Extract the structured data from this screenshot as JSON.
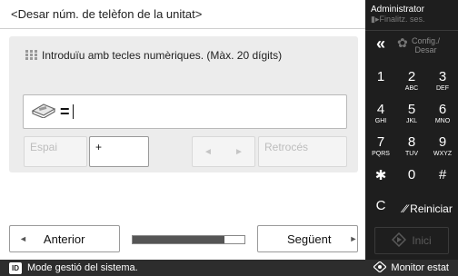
{
  "screen": {
    "title": "<Desar núm. de telèfon de la unitat>",
    "instruction": "Introduïu amb tecles numèriques. (Màx. 20 dígits)",
    "field_value": "=",
    "buttons": {
      "space": "Espai",
      "plus": "+",
      "left_arrow": "◄",
      "right_arrow": "►",
      "backspace": "Retrocés"
    },
    "nav": {
      "previous": "Anterior",
      "next": "Següent",
      "prev_arrow": "◄",
      "next_arrow": "►",
      "progress_fraction": 0.82
    }
  },
  "status_bar": {
    "badge": "ID",
    "message": "Mode gestió del sistema.",
    "monitor": "Monitor estat"
  },
  "side_panel": {
    "user": "Administrator",
    "logout": "Finalitz. ses.",
    "config": "Config./",
    "config2": "Desar",
    "keys": [
      {
        "n": "1",
        "l": ""
      },
      {
        "n": "2",
        "l": "ABC"
      },
      {
        "n": "3",
        "l": "DEF"
      },
      {
        "n": "4",
        "l": "GHI"
      },
      {
        "n": "5",
        "l": "JKL"
      },
      {
        "n": "6",
        "l": "MNO"
      },
      {
        "n": "7",
        "l": "PQRS"
      },
      {
        "n": "8",
        "l": "TUV"
      },
      {
        "n": "9",
        "l": "WXYZ"
      },
      {
        "n": "✱",
        "l": ""
      },
      {
        "n": "0",
        "l": ""
      },
      {
        "n": "#",
        "l": ""
      }
    ],
    "clear": "C",
    "reset": "Reiniciar",
    "start": "Inici",
    "collapse": "«"
  },
  "colors": {
    "keypad_bg": "#1e1e1e",
    "status_bg": "#2d2d2d",
    "panel_bg": "#ececec"
  }
}
